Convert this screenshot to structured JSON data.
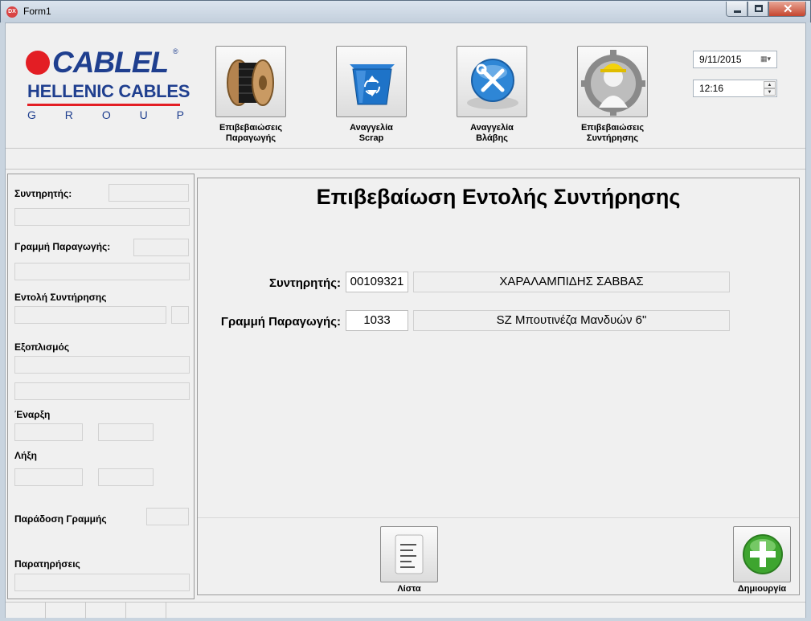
{
  "window": {
    "title": "Form1",
    "app_icon": "DX"
  },
  "logo": {
    "word": "CABLEL",
    "reg": "®",
    "sub": "HELLENIC CABLES",
    "group_letters": [
      "G",
      "R",
      "O",
      "U",
      "P"
    ],
    "brand_red": "#e31e24",
    "brand_blue": "#1f3f8f"
  },
  "nav": [
    {
      "icon": "cable-reel-icon",
      "line1": "Επιβεβαιώσεις",
      "line2": "Παραγωγής"
    },
    {
      "icon": "recycle-bin-icon",
      "line1": "Αναγγελία",
      "line2": "Scrap"
    },
    {
      "icon": "repair-tools-icon",
      "line1": "Αναγγελία",
      "line2": "Βλάβης"
    },
    {
      "icon": "technician-gear-icon",
      "line1": "Επιβεβαιώσεις",
      "line2": "Συντήρησης"
    }
  ],
  "date": "9/11/2015",
  "time": "12:16",
  "left": {
    "technician": "Συντηρητής:",
    "line": "Γραμμή Παραγωγής:",
    "order": "Εντολή Συντήρησης",
    "equipment": "Εξοπλισμός",
    "start": "Έναρξη",
    "end": "Λήξη",
    "handover": "Παράδοση Γραμμής",
    "notes": "Παρατηρήσεις"
  },
  "main": {
    "title": "Επιβεβαίωση Εντολής Συντήρησης",
    "technician_label": "Συντηρητής:",
    "technician_code": "00109321",
    "technician_name": "ΧΑΡΑΛΑΜΠΙΔΗΣ ΣΑΒΒΑΣ",
    "line_label": "Γραμμή Παραγωγής:",
    "line_code": "1033",
    "line_name": "SZ Μπουτινέζα Μανδυών 6\""
  },
  "actions": {
    "list": "Λίστα",
    "create": "Δημιουργία"
  }
}
